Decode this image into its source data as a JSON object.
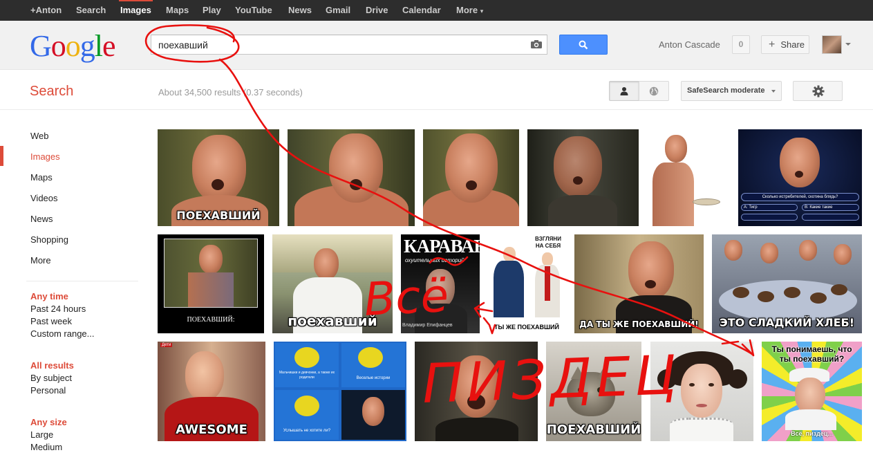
{
  "topbar": {
    "items": [
      "+Anton",
      "Search",
      "Images",
      "Maps",
      "Play",
      "YouTube",
      "News",
      "Gmail",
      "Drive",
      "Calendar",
      "More"
    ],
    "active": "Images",
    "more_caret": "▾"
  },
  "header": {
    "logo": "Google",
    "query": "поехавший",
    "user_name": "Anton Cascade",
    "notifications": "0",
    "share_label": "Share"
  },
  "subbar": {
    "title": "Search",
    "result_stats": "About 34,500 results (0.37 seconds)",
    "safesearch": "SafeSearch moderate"
  },
  "leftnav": {
    "items": [
      "Web",
      "Images",
      "Maps",
      "Videos",
      "News",
      "Shopping",
      "More"
    ],
    "active": "Images",
    "filters": [
      {
        "heading": "Any time",
        "options": [
          "Past 24 hours",
          "Past week",
          "Custom range..."
        ]
      },
      {
        "heading": "All results",
        "options": [
          "By subject",
          "Personal"
        ]
      },
      {
        "heading": "Any size",
        "options": [
          "Large",
          "Medium"
        ]
      }
    ]
  },
  "results": {
    "captions": [
      "ПОЕХАВШИЙ",
      "",
      "",
      "",
      "",
      "",
      "ПОЕХАВШИЙ:",
      "поехавший",
      "КАРАВАН",
      "ТЫ ЖЕ ПОЕХАВШИЙ",
      "ДА ТЫ ЖЕ ПОЕХАВШИЙ!",
      "ЭТО СЛАДКИЙ ХЛЕБ!",
      "AWESOME",
      "",
      "",
      "ПОЕХАВШИЙ",
      "",
      "Ты понимаешь, что ты поехавший?"
    ],
    "extra_text": {
      "quiz_question": "Сколько истребителей, скотина блядь?",
      "quiz_a": "A: Тигр",
      "quiz_b": "B: Какие такие истребители?",
      "karavan_sub": "охуительных историй",
      "karavan_author": "Владимир Епифанцев",
      "vzglyani": "ВЗГЛЯНИ НА СЕБЯ",
      "yeralash_1": "Мальчишки и девчонки, а также их родители",
      "yeralash_2": "Веселые истории",
      "yeralash_3": "Услышать не хотите ли?",
      "deti": "Дети",
      "vse_pizdec": "Всё, пиздец..."
    }
  },
  "annotations": {
    "word1": "Всё",
    "word2": "ПИЗДЕЦ",
    "ink_color": "#e8110f"
  }
}
